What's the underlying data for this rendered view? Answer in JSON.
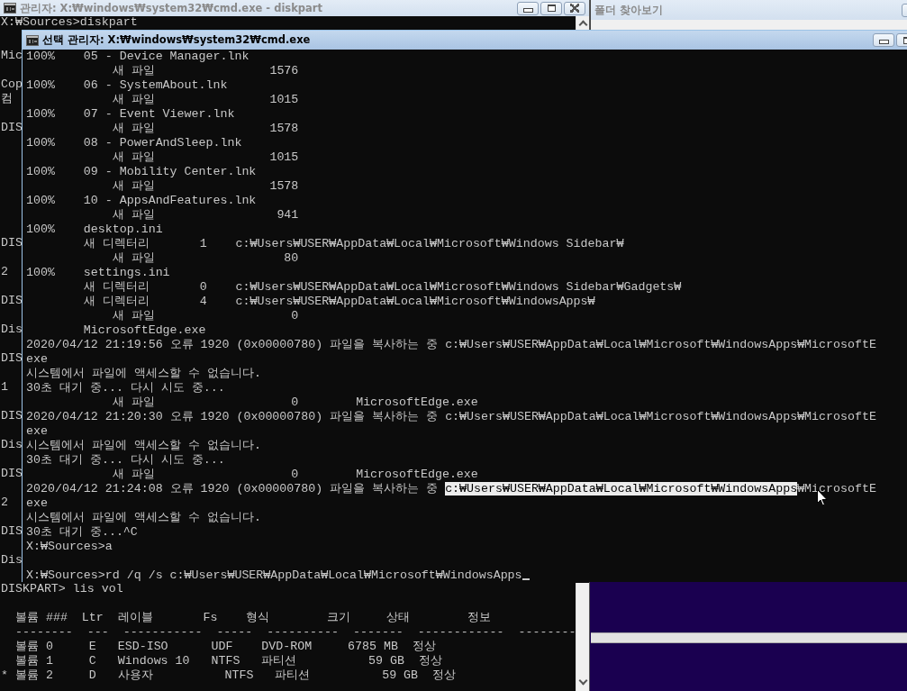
{
  "back_window": {
    "title": "관리자: X:₩windows₩system32₩cmd.exe - diskpart",
    "active": false,
    "first_line": "X:₩Sources>diskpart",
    "left_lines": [
      {
        "kind": "text",
        "text": "Mic"
      },
      {
        "kind": "blank"
      },
      {
        "kind": "text",
        "text": "Cop"
      },
      {
        "kind": "text",
        "text": "컴"
      },
      {
        "kind": "blank"
      },
      {
        "kind": "text",
        "text": "DIS"
      },
      {
        "kind": "blank"
      },
      {
        "kind": "blank"
      },
      {
        "kind": "blank"
      },
      {
        "kind": "blank"
      },
      {
        "kind": "blank"
      },
      {
        "kind": "blank"
      },
      {
        "kind": "blank"
      },
      {
        "kind": "text",
        "text": "DIS"
      },
      {
        "kind": "blank"
      },
      {
        "kind": "text",
        "text": "2"
      },
      {
        "kind": "blank"
      },
      {
        "kind": "text",
        "text": "DIS"
      },
      {
        "kind": "blank"
      },
      {
        "kind": "text",
        "text": "Dis"
      },
      {
        "kind": "blank"
      },
      {
        "kind": "text",
        "text": "DIS"
      },
      {
        "kind": "blank"
      },
      {
        "kind": "text",
        "text": "1"
      },
      {
        "kind": "blank"
      },
      {
        "kind": "text",
        "text": "DIS"
      },
      {
        "kind": "blank"
      },
      {
        "kind": "text",
        "text": "Dis"
      },
      {
        "kind": "blank"
      },
      {
        "kind": "text",
        "text": "DIS"
      },
      {
        "kind": "blank"
      },
      {
        "kind": "text",
        "text": "2"
      },
      {
        "kind": "blank"
      },
      {
        "kind": "text",
        "text": "DIS"
      },
      {
        "kind": "blank"
      },
      {
        "kind": "text",
        "text": "Dis"
      },
      {
        "kind": "blank"
      }
    ],
    "bottom_lines": [
      {
        "kind": "text",
        "text": "DISKPART> lis vol"
      },
      {
        "kind": "blank"
      },
      {
        "kind": "text",
        "text": "  볼륨 ###  Ltr  레이블       Fs    형식        크기     상태        정보"
      },
      {
        "kind": "text",
        "text": "  --------  ---  -----------  -----  ----------  -------  ------------  --------"
      },
      {
        "kind": "text",
        "text": "  볼륨 0     E   ESD-ISO      UDF    DVD-ROM     6785 MB  정상"
      },
      {
        "kind": "text",
        "text": "  볼륨 1     C   Windows 10   NTFS   파티션          59 GB  정상"
      },
      {
        "kind": "text",
        "text": "* 볼륨 2     D   사용자          NTFS   파티션          59 GB  정상"
      }
    ]
  },
  "folder_window": {
    "title": "폴더 찾아보기",
    "active": false
  },
  "front_window": {
    "title": "선택 관리자: X:₩windows₩system32₩cmd.exe",
    "active": true,
    "lines": [
      {
        "kind": "text",
        "text": "100%    05 - Device Manager.lnk"
      },
      {
        "kind": "text",
        "text": "            새 파일                1576"
      },
      {
        "kind": "text",
        "text": "100%    06 - SystemAbout.lnk"
      },
      {
        "kind": "text",
        "text": "            새 파일                1015"
      },
      {
        "kind": "text",
        "text": "100%    07 - Event Viewer.lnk"
      },
      {
        "kind": "text",
        "text": "            새 파일                1578"
      },
      {
        "kind": "text",
        "text": "100%    08 - PowerAndSleep.lnk"
      },
      {
        "kind": "text",
        "text": "            새 파일                1015"
      },
      {
        "kind": "text",
        "text": "100%    09 - Mobility Center.lnk"
      },
      {
        "kind": "text",
        "text": "            새 파일                1578"
      },
      {
        "kind": "text",
        "text": "100%    10 - AppsAndFeatures.lnk"
      },
      {
        "kind": "text",
        "text": "            새 파일                 941"
      },
      {
        "kind": "text",
        "text": "100%    desktop.ini"
      },
      {
        "kind": "text",
        "text": "        새 디렉터리       1    c:₩Users₩USER₩AppData₩Local₩Microsoft₩Windows Sidebar₩"
      },
      {
        "kind": "text",
        "text": "            새 파일                  80"
      },
      {
        "kind": "text",
        "text": "100%    settings.ini"
      },
      {
        "kind": "text",
        "text": "        새 디렉터리       0    c:₩Users₩USER₩AppData₩Local₩Microsoft₩Windows Sidebar₩Gadgets₩"
      },
      {
        "kind": "text",
        "text": "        새 디렉터리       4    c:₩Users₩USER₩AppData₩Local₩Microsoft₩WindowsApps₩"
      },
      {
        "kind": "text",
        "text": "            새 파일                   0"
      },
      {
        "kind": "text",
        "text": "        MicrosoftEdge.exe"
      },
      {
        "kind": "text",
        "text": "2020/04/12 21:19:56 오류 1920 (0x00000780) 파일을 복사하는 중 c:₩Users₩USER₩AppData₩Local₩Microsoft₩WindowsApps₩MicrosoftE"
      },
      {
        "kind": "text",
        "text": "exe"
      },
      {
        "kind": "text",
        "text": "시스템에서 파일에 액세스할 수 없습니다."
      },
      {
        "kind": "text",
        "text": "30초 대기 중... 다시 시도 중..."
      },
      {
        "kind": "text",
        "text": "            새 파일                   0        MicrosoftEdge.exe"
      },
      {
        "kind": "text",
        "text": "2020/04/12 21:20:30 오류 1920 (0x00000780) 파일을 복사하는 중 c:₩Users₩USER₩AppData₩Local₩Microsoft₩WindowsApps₩MicrosoftE"
      },
      {
        "kind": "text",
        "text": "exe"
      },
      {
        "kind": "text",
        "text": "시스템에서 파일에 액세스할 수 없습니다."
      },
      {
        "kind": "text",
        "text": "30초 대기 중... 다시 시도 중..."
      },
      {
        "kind": "text",
        "text": "            새 파일                   0        MicrosoftEdge.exe"
      },
      {
        "kind": "segments",
        "segments": [
          {
            "text": "2020/04/12 21:24:08 오류 1920 (0x00000780) 파일을 복사하는 중 ",
            "selected": false
          },
          {
            "text": "c:₩Users₩USER₩AppData₩Local₩Microsoft₩WindowsApps",
            "selected": true
          },
          {
            "text": "₩MicrosoftE",
            "selected": false
          }
        ]
      },
      {
        "kind": "text",
        "text": "exe"
      },
      {
        "kind": "text",
        "text": "시스템에서 파일에 액세스할 수 없습니다."
      },
      {
        "kind": "text",
        "text": "30초 대기 중...^C"
      },
      {
        "kind": "text",
        "text": "X:₩Sources>a"
      },
      {
        "kind": "blank"
      }
    ],
    "prompt": {
      "text": "X:₩Sources>rd /q /s c:₩Users₩USER₩AppData₩Local₩Microsoft₩WindowsApps",
      "cursor": true
    }
  }
}
